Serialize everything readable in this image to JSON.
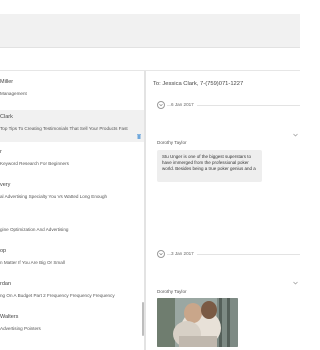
{
  "conversations": [
    {
      "name": "Miller",
      "snippet": "Management"
    },
    {
      "name": "Clark",
      "snippet": "Top Tips To Creating Testimonials That Sell Your Products Fast"
    },
    {
      "name": "r",
      "snippet": "Keyword Research For Beginners"
    },
    {
      "name": "very",
      "snippet": "al Advertising Specialty You Vs Watted Long Enough"
    },
    {
      "name": "",
      "snippet": "gine Optimization And Advertising"
    },
    {
      "name": "op",
      "snippet": "n Matter If You Are Big Or Small"
    },
    {
      "name": "rdan",
      "snippet": "ng On A Budget Part 2 Frequency Frequency Frequency"
    },
    {
      "name": "Walters",
      "snippet": "Advertising Pointers"
    }
  ],
  "chat": {
    "to_label": "To:",
    "recipient": "Jessica Clark, 7-(759)071-1227",
    "messages": [
      {
        "date": "6 Jan 2017",
        "sender": "Dorothy Taylor",
        "text": "Stu Unger is one of the biggest superstars to have immerged from the professional poker world. Besides being a true poker genius and a"
      },
      {
        "date": "3 Jan 2017",
        "sender": "Dorothy Taylor"
      }
    ]
  },
  "colors": {
    "top_bar": "#f1f1f1",
    "active_item": "#f1f1f1",
    "bubble": "#eeeeee",
    "trash_icon": "#6fa8dc"
  }
}
